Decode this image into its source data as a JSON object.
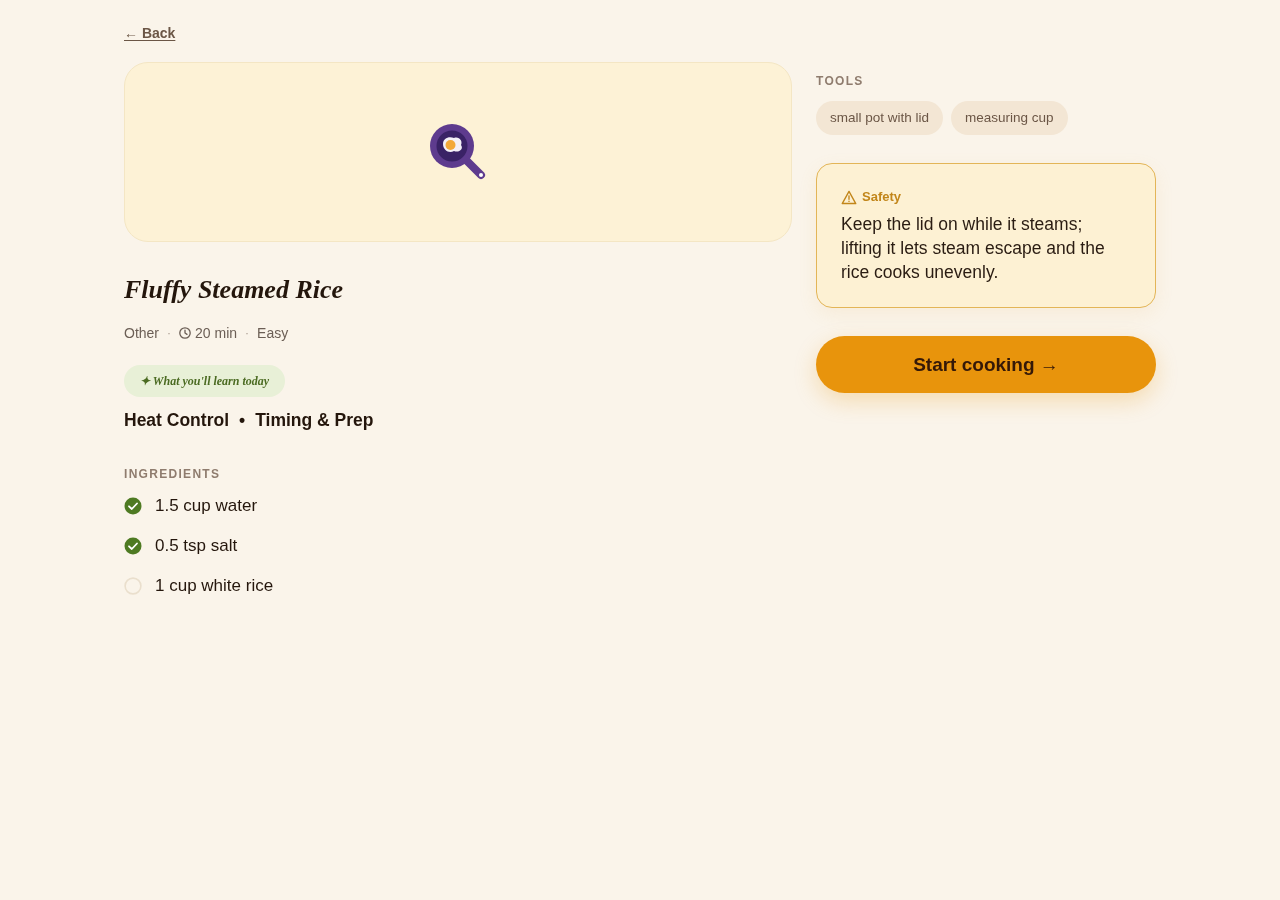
{
  "back_link": {
    "label": "← Back"
  },
  "recipe": {
    "title": "Fluffy Steamed Rice",
    "meta_separator": "·",
    "meta": [
      {
        "kind": "text",
        "label": "Other"
      },
      {
        "kind": "time",
        "label": "20 min"
      },
      {
        "kind": "text",
        "label": "Easy"
      }
    ]
  },
  "learn": {
    "badge": "✦ What you'll learn today",
    "separator": "•",
    "skills": [
      "Heat Control",
      "Timing & Prep"
    ]
  },
  "ingredients": {
    "heading": "INGREDIENTS",
    "items": [
      {
        "label": "1.5 cup water",
        "checked": true
      },
      {
        "label": "0.5 tsp salt",
        "checked": true
      },
      {
        "label": "1 cup white rice",
        "checked": false
      }
    ]
  },
  "tools": {
    "heading": "TOOLS",
    "items": [
      "small pot with lid",
      "measuring cup"
    ]
  },
  "safety": {
    "title": "Safety",
    "text": "Keep the lid on while it steams; lifting it lets steam escape and the rice cooks unevenly."
  },
  "start_button": {
    "label": "Start cooking →"
  }
}
